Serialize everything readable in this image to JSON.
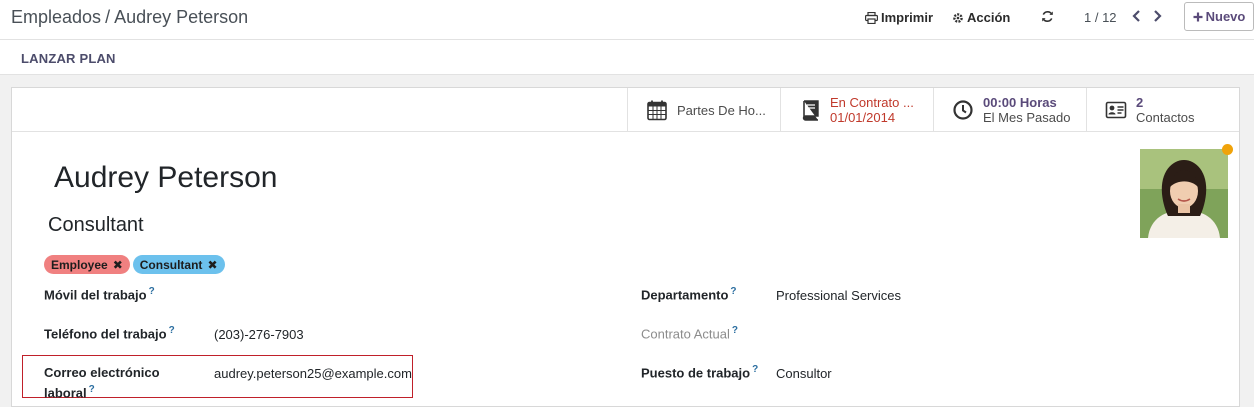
{
  "breadcrumb": {
    "parent": "Empleados",
    "separator": "/",
    "current": "Audrey Peterson"
  },
  "toolbar": {
    "print_label": "Imprimir",
    "action_label": "Acción",
    "pager": "1 / 12",
    "new_label": "Nuevo"
  },
  "actionbar": {
    "launch_plan_label": "LANZAR PLAN"
  },
  "smart_buttons": [
    {
      "icon": "calendar-icon",
      "line1": "Partes De Ho..."
    },
    {
      "icon": "book-icon",
      "line1": "En Contrato ...",
      "line2": "01/01/2014",
      "color": "#c0392b"
    },
    {
      "icon": "clock-icon",
      "line1": "00:00 Horas",
      "line2": "El Mes Pasado"
    },
    {
      "icon": "address-card-icon",
      "line1": "2",
      "line2": "Contactos"
    }
  ],
  "employee": {
    "name": "Audrey Peterson",
    "job_title": "Consultant",
    "status_color": "#f0a30a",
    "tags": [
      {
        "label": "Employee",
        "color": "#f08080"
      },
      {
        "label": "Consultant",
        "color": "#6cc1ed"
      }
    ]
  },
  "fields": {
    "mobile_label": "Móvil del trabajo",
    "mobile_value": "",
    "phone_label": "Teléfono del trabajo",
    "phone_value": "(203)-276-7903",
    "email_label_1": "Correo electrónico",
    "email_label_2": "laboral",
    "email_value": "audrey.peterson25@example.com",
    "department_label": "Departamento",
    "department_value": "Professional Services",
    "contract_label": "Contrato Actual",
    "contract_value": "",
    "job_position_label": "Puesto de trabajo",
    "job_position_value": "Consultor",
    "help_marker": "?"
  },
  "colors": {
    "accent": "#5a4a7a",
    "highlight_border": "#c0202a"
  }
}
